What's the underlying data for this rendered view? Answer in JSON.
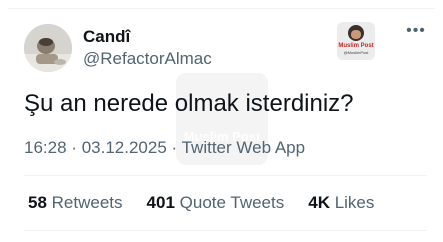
{
  "author": {
    "name": "Candî",
    "handle": "@RefactorAlmac"
  },
  "badge": {
    "title": "Muslim Post",
    "subtitle": "@MuslimPost"
  },
  "more_icon": "ellipsis-icon",
  "watermark": {
    "text": "Muslim Post"
  },
  "tweet": {
    "text": "Şu an nerede olmak isterdiniz?",
    "time": "16:28",
    "separator": "·",
    "date": "03.12.2025",
    "source": "Twitter Web App"
  },
  "stats": {
    "retweets": {
      "count": "58",
      "label": "Retweets"
    },
    "quote_tweets": {
      "count": "401",
      "label": "Quote Tweets"
    },
    "likes": {
      "count": "4K",
      "label": "Likes"
    }
  }
}
